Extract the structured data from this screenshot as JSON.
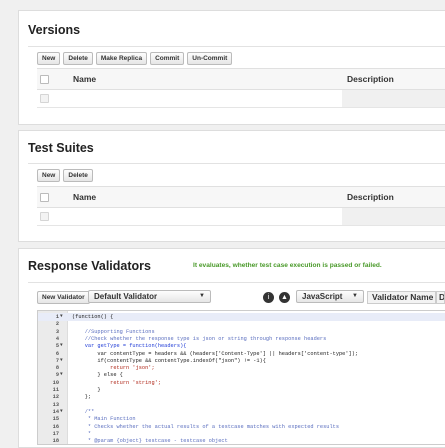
{
  "versions": {
    "title": "Versions",
    "buttons": [
      "New",
      "Delete",
      "Make Replica",
      "Commit",
      "Un-Commit"
    ],
    "columns": {
      "name": "Name",
      "description": "Description"
    }
  },
  "test_suites": {
    "title": "Test Suites",
    "buttons": [
      "New",
      "Delete"
    ],
    "columns": {
      "name": "Name",
      "description": "Description"
    }
  },
  "response_validators": {
    "title": "Response Validators",
    "note": "It evaluates, whether test case execution is passed or failed.",
    "new_button": "New Validator",
    "validator_select": "Default Validator",
    "language_select": "JavaScript",
    "column_validator_name": "Validator Name",
    "column_cut": "D"
  },
  "editor": {
    "lines": [
      {
        "n": "1",
        "fold": true,
        "text": "(function() {",
        "cls": "tx"
      },
      {
        "n": "2",
        "fold": false,
        "text": "",
        "cls": "tx"
      },
      {
        "n": "3",
        "fold": false,
        "text": "    //Supporting Functions",
        "cls": "cm"
      },
      {
        "n": "4",
        "fold": false,
        "text": "    //Check whether the response type is json or string through response headers",
        "cls": "cm"
      },
      {
        "n": "5",
        "fold": true,
        "text": "    var getType = function(headers){",
        "cls": "kw"
      },
      {
        "n": "6",
        "fold": false,
        "text": "        var contentType = headers && (headers['Content-Type'] || headers['content-type']);",
        "cls": "tx"
      },
      {
        "n": "7",
        "fold": true,
        "text": "        if(contentType && contentType.indexOf(\"json\") != -1){",
        "cls": "tx"
      },
      {
        "n": "8",
        "fold": false,
        "text": "            return 'json';",
        "cls": "st"
      },
      {
        "n": "9",
        "fold": true,
        "text": "        } else {",
        "cls": "tx"
      },
      {
        "n": "10",
        "fold": false,
        "text": "            return 'string';",
        "cls": "st"
      },
      {
        "n": "11",
        "fold": false,
        "text": "        }",
        "cls": "tx"
      },
      {
        "n": "12",
        "fold": false,
        "text": "    };",
        "cls": "tx"
      },
      {
        "n": "13",
        "fold": false,
        "text": "",
        "cls": "tx"
      },
      {
        "n": "14",
        "fold": true,
        "text": "    /**",
        "cls": "cm"
      },
      {
        "n": "15",
        "fold": false,
        "text": "     * Main Function",
        "cls": "cm"
      },
      {
        "n": "16",
        "fold": false,
        "text": "     * Checks whether the actual results of a testcase matches with expected results",
        "cls": "cm"
      },
      {
        "n": "17",
        "fold": false,
        "text": "     *",
        "cls": "cm"
      },
      {
        "n": "18",
        "fold": false,
        "text": "     * @param {object} testcase - testcase object",
        "cls": "cm"
      }
    ]
  }
}
